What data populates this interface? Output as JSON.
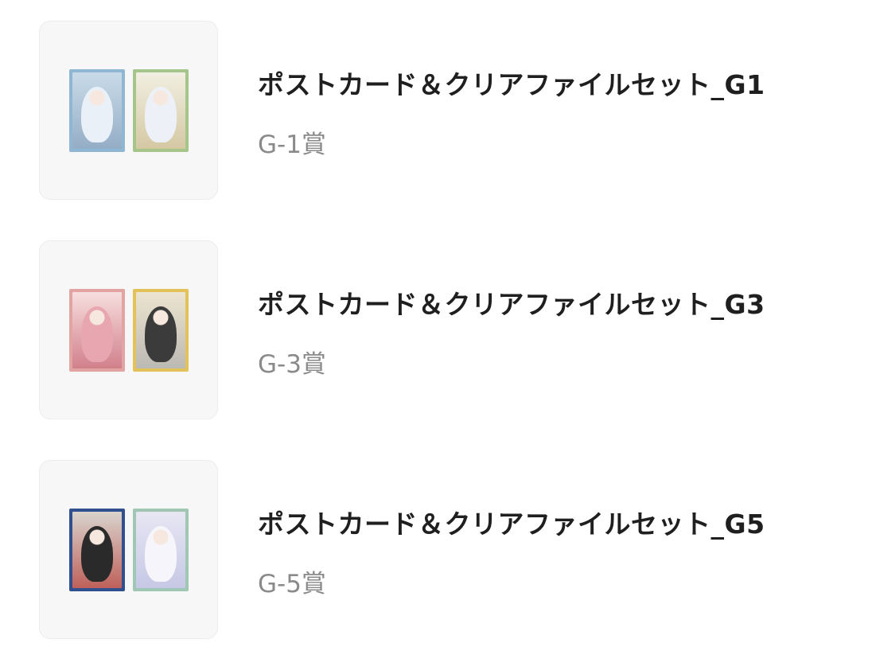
{
  "items": [
    {
      "title": "ポストカード＆クリアファイルセット_G1",
      "prize": "G-1賞",
      "cards": [
        {
          "frame": "#8fb6d2",
          "bg": "#c9dbe8",
          "figure": "#e9f0f7",
          "accent": "#7f9bb8"
        },
        {
          "frame": "#a6c58a",
          "bg": "#f1efe2",
          "figure": "#eef0f8",
          "accent": "#c9b98a"
        }
      ]
    },
    {
      "title": "ポストカード＆クリアファイルセット_G3",
      "prize": "G-3賞",
      "cards": [
        {
          "frame": "#e2a3a3",
          "bg": "#f7dede",
          "figure": "#e7a6b0",
          "accent": "#c25a6a"
        },
        {
          "frame": "#e3c25a",
          "bg": "#ece4cf",
          "figure": "#3b3b3b",
          "accent": "#a8a8a8"
        }
      ]
    },
    {
      "title": "ポストカード＆クリアファイルセット_G5",
      "prize": "G-5賞",
      "cards": [
        {
          "frame": "#2f4f8f",
          "bg": "#d8d4cd",
          "figure": "#2a2a2a",
          "accent": "#b5322c"
        },
        {
          "frame": "#9fc7b3",
          "bg": "#e7e6f3",
          "figure": "#f5f5fb",
          "accent": "#b9bce0"
        }
      ]
    }
  ]
}
